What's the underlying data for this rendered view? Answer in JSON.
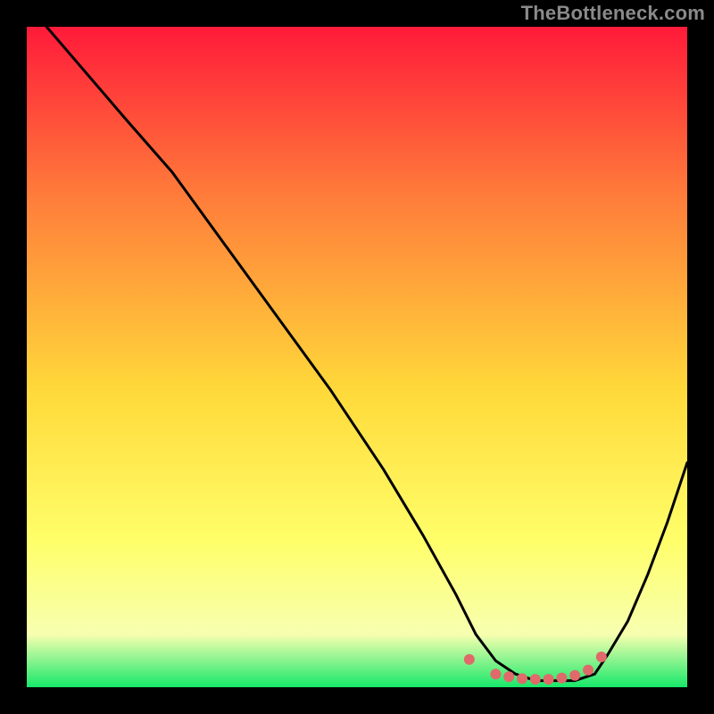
{
  "watermark": "TheBottleneck.com",
  "chart_data": {
    "type": "line",
    "title": "",
    "xlabel": "",
    "ylabel": "",
    "xlim": [
      0,
      100
    ],
    "ylim": [
      0,
      100
    ],
    "grid": false,
    "legend": false,
    "annotations": [],
    "background_gradient": {
      "top": "#ff1a3a",
      "mid_upper": "#ff7a3a",
      "mid": "#ffd93a",
      "mid_lower": "#ffff6a",
      "band": "#f7ffb0",
      "bottom": "#17e86a"
    },
    "series": [
      {
        "name": "curve",
        "color": "#000000",
        "x": [
          3,
          9,
          15,
          22,
          30,
          38,
          46,
          54,
          60,
          65,
          68,
          71,
          74,
          77,
          80,
          83,
          86,
          88,
          91,
          94,
          97,
          100
        ],
        "y": [
          100,
          93,
          86,
          78,
          67,
          56,
          45,
          33,
          23,
          14,
          8,
          4,
          2,
          1,
          1,
          1,
          2,
          5,
          10,
          17,
          25,
          34
        ]
      }
    ],
    "markers": {
      "name": "bottom-flat-dots",
      "color": "#e06a6a",
      "x": [
        67,
        71,
        73,
        75,
        77,
        79,
        81,
        83,
        85,
        87
      ],
      "y": [
        4.2,
        2.0,
        1.6,
        1.3,
        1.2,
        1.2,
        1.4,
        1.8,
        2.6,
        4.6
      ]
    }
  }
}
